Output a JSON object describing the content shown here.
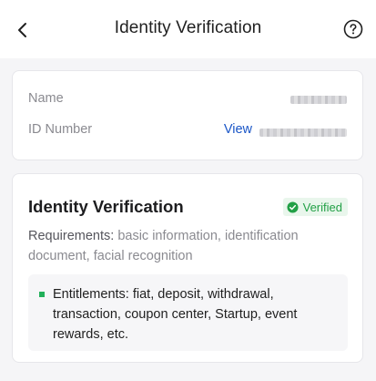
{
  "header": {
    "title": "Identity Verification",
    "back_icon": "chevron-left-icon",
    "help_icon": "question-circle-icon"
  },
  "info": {
    "name_label": "Name",
    "id_label": "ID Number",
    "view_label": "View"
  },
  "verification": {
    "title": "Identity Verification",
    "status": "Verified",
    "status_color": "#22a046",
    "requirements_label": "Requirements:",
    "requirements_text": "basic information, identification document, facial recognition",
    "entitlements_label": "Entitlements:",
    "entitlements_text": "fiat, deposit, withdrawal, transaction, coupon center, Startup, event rewards, etc."
  },
  "colors": {
    "link": "#1a56c7",
    "accent_green": "#22b05a"
  }
}
